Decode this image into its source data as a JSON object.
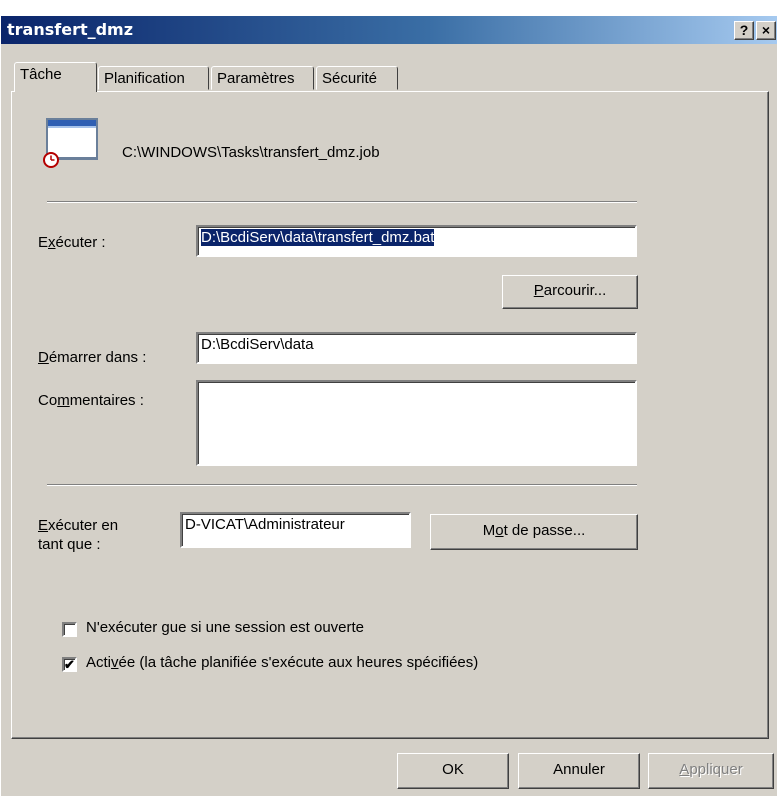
{
  "window": {
    "title": "transfert_dmz",
    "help_button": "?",
    "close_button": "×"
  },
  "tabs": [
    {
      "label": "Tâche",
      "active": true
    },
    {
      "label": "Planification",
      "active": false
    },
    {
      "label": "Paramètres",
      "active": false
    },
    {
      "label": "Sécurité",
      "active": false
    }
  ],
  "task": {
    "job_path": "C:\\WINDOWS\\Tasks\\transfert_dmz.job",
    "icon": "scheduled-task-icon",
    "run_label": "Exécuter :",
    "run_value": "D:\\BcdiServ\\data\\transfert_dmz.bat",
    "browse_label": "Parcourir...",
    "start_in_label": "Démarrer dans :",
    "start_in_value": "D:\\BcdiServ\\data",
    "comments_label": "Commentaires :",
    "comments_value": "",
    "run_as_label_line1": "Exécuter en",
    "run_as_label_line2": "tant que :",
    "run_as_value": "D-VICAT\\Administrateur",
    "password_label": "Mot de passe..."
  },
  "options": {
    "only_logged_on_label": "N'exécuter gue si une session est ouverte",
    "only_logged_on_checked": false,
    "enabled_label": "Activée (la tâche planifiée s'exécute aux heures spécifiées)",
    "enabled_checked": true,
    "check_mark": "✔"
  },
  "footer": {
    "ok_label": "OK",
    "cancel_label": "Annuler",
    "apply_label": "Appliquer",
    "apply_enabled": false
  },
  "colors": {
    "titlebar_start": "#0a246a",
    "titlebar_end": "#a6caf0",
    "face": "#d4d0c8",
    "selection": "#0a246a"
  }
}
